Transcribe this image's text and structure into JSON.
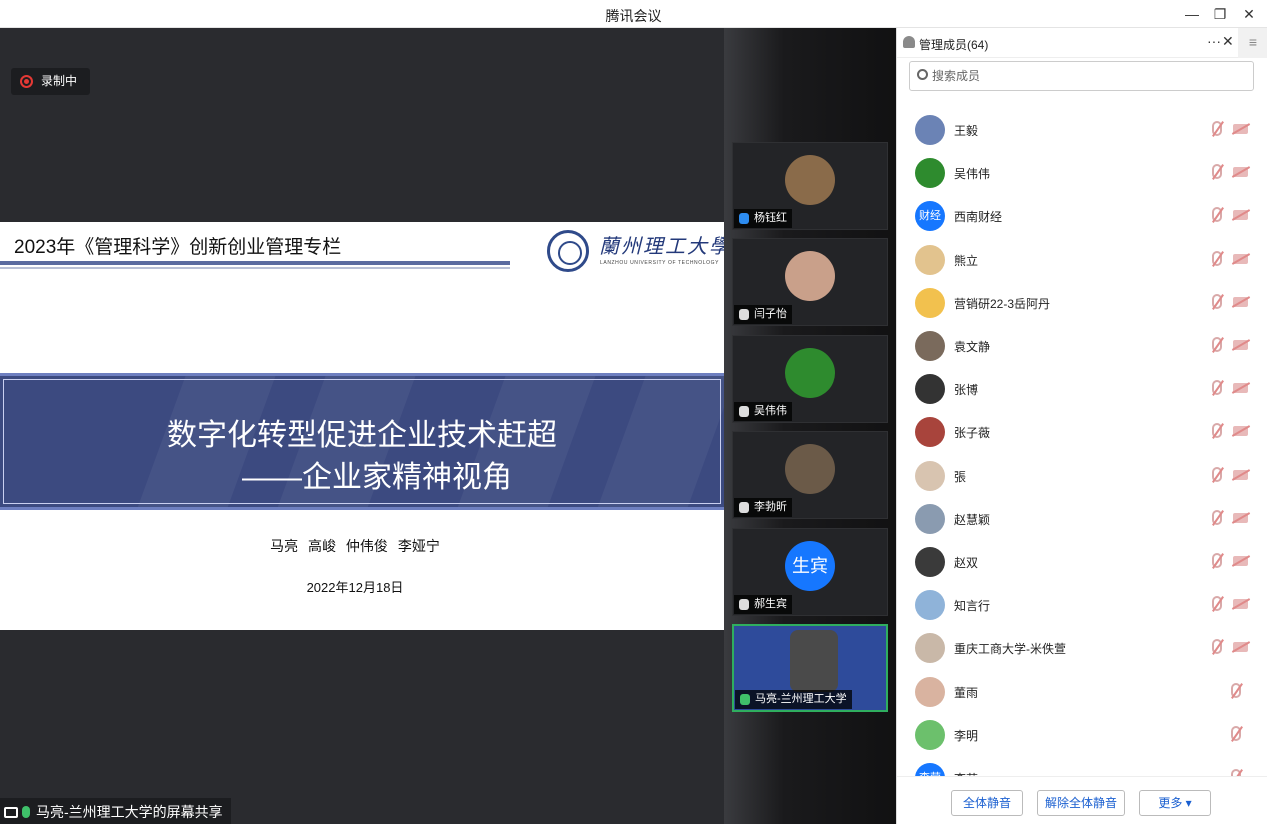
{
  "window": {
    "title": "腾讯会议",
    "minimize_glyph": "—",
    "restore_glyph": "❐",
    "close_glyph": "✕"
  },
  "recording": {
    "label": "录制中",
    "color": "#e53935"
  },
  "slide": {
    "header": "2023年《管理科学》创新创业管理专栏",
    "logo_cn": "蘭州理工大學",
    "logo_en": "LANZHOU UNIVERSITY OF TECHNOLOGY",
    "title_line1": "数字化转型促进企业技术赶超",
    "title_line2": "——企业家精神视角",
    "authors": "马亮  高峻  仲伟俊  李娅宁",
    "date": "2022年12月18日"
  },
  "share_bar": {
    "label": "马亮-兰州理工大学的屏幕共享"
  },
  "gallery": [
    {
      "name": "杨钰红",
      "icon": "user-icon",
      "avatar_color": "#8a6b4a"
    },
    {
      "name": "闫子怡",
      "icon": "mic-off-icon",
      "avatar_color": "#c9a08a"
    },
    {
      "name": "吴伟伟",
      "icon": "mic-off-icon",
      "avatar_color": "#2e8b2e"
    },
    {
      "name": "李勃昕",
      "icon": "mic-off-icon",
      "avatar_color": "#6b5a48"
    },
    {
      "name": "郝生宾",
      "icon": "mic-off-icon",
      "avatar_text": "生宾",
      "avatar_color": "#1677ff"
    },
    {
      "name": "马亮-兰州理工大学",
      "icon": "mic-on-icon",
      "avatar_color": "#2e4b9b",
      "active": true
    }
  ],
  "panel": {
    "title": "管理成员(64)",
    "more_glyph": "···",
    "close_glyph": "✕",
    "menu_glyph": "≡",
    "search_placeholder": "搜索成员",
    "members": [
      {
        "name": "王毅",
        "avatar_color": "#6b83b5",
        "avatar_text": ""
      },
      {
        "name": "吴伟伟",
        "avatar_color": "#2e8b2e",
        "avatar_text": ""
      },
      {
        "name": "西南财经",
        "avatar_color": "#1677ff",
        "avatar_text": "财经"
      },
      {
        "name": "熊立",
        "avatar_color": "#e2c38e",
        "avatar_text": ""
      },
      {
        "name": "营销研22-3岳阿丹",
        "avatar_color": "#f2c14e",
        "avatar_text": ""
      },
      {
        "name": "袁文静",
        "avatar_color": "#7a6a5c",
        "avatar_text": ""
      },
      {
        "name": "张博",
        "avatar_color": "#333333",
        "avatar_text": ""
      },
      {
        "name": "张子薇",
        "avatar_color": "#a8443c",
        "avatar_text": ""
      },
      {
        "name": "張",
        "avatar_color": "#d8c4b0",
        "avatar_text": ""
      },
      {
        "name": "赵慧颖",
        "avatar_color": "#8a9bb0",
        "avatar_text": ""
      },
      {
        "name": "赵双",
        "avatar_color": "#3a3a3a",
        "avatar_text": ""
      },
      {
        "name": "知言行",
        "avatar_color": "#8fb3d9",
        "avatar_text": ""
      },
      {
        "name": "重庆工商大学-米佚萱",
        "avatar_color": "#c9b8a8",
        "avatar_text": ""
      },
      {
        "name": "董雨",
        "avatar_color": "#d9b3a0",
        "avatar_text": ""
      },
      {
        "name": "李明",
        "avatar_color": "#6cc06c",
        "avatar_text": ""
      },
      {
        "name": "李莹",
        "avatar_color": "#1677ff",
        "avatar_text": "李莹"
      }
    ],
    "buttons": {
      "mute_all": "全体静音",
      "unmute_all": "解除全体静音",
      "more": "更多 ▾"
    }
  },
  "colors": {
    "accent": "#1677ff",
    "speaking_green": "#2fae5f",
    "slide_band": "#3c4a80"
  }
}
